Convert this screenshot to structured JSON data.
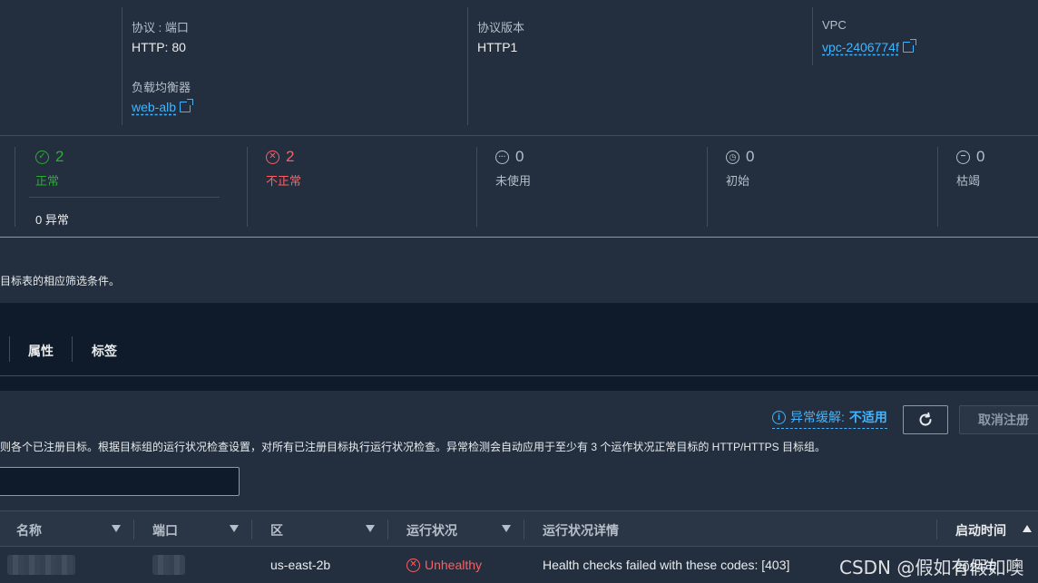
{
  "details": {
    "protocol_port_label": "协议 : 端口",
    "protocol_port_value": "HTTP: 80",
    "protocol_version_label": "协议版本",
    "protocol_version_value": "HTTP1",
    "vpc_label": "VPC",
    "vpc_value": "vpc-2406774f",
    "load_balancer_label": "负载均衡器",
    "load_balancer_value": "web-alb"
  },
  "status": {
    "healthy_count": "2",
    "healthy_label": "正常",
    "anomalous_text": "0 异常",
    "unhealthy_count": "2",
    "unhealthy_label": "不正常",
    "unused_count": "0",
    "unused_label": "未使用",
    "initial_count": "0",
    "initial_label": "初始",
    "draining_count": "0",
    "draining_label": "枯竭"
  },
  "filter_notice": "目标表的相应筛选条件。",
  "tabs": [
    {
      "label": "属性"
    },
    {
      "label": "标签"
    }
  ],
  "targets": {
    "anomaly_mitigation_label": "异常缓解:",
    "anomaly_mitigation_value": "不适用",
    "deregister_label": "取消注册",
    "description": "则各个已注册目标。根据目标组的运行状况检查设置，对所有已注册目标执行运行状况检查。异常检测会自动应用于至少有 3 个运作状况正常目标的 HTTP/HTTPS 目标组。",
    "columns": {
      "name": "名称",
      "port": "端口",
      "zone": "区",
      "health_status": "运行状况",
      "health_details": "运行状况详情",
      "launch_time": "启动时间"
    },
    "rows": [
      {
        "zone": "us-east-2b",
        "health_status": "Unhealthy",
        "health_details": "Health checks failed with these codes: [403]",
        "launch_time": "2024年"
      }
    ]
  },
  "watermark": "CSDN @假如有假如噢",
  "colors": {
    "background": "#232f3e",
    "dark_background": "#0f1b2a",
    "link": "#42b4ff",
    "healthy": "#29ad32",
    "unhealthy": "#ff5d64"
  }
}
